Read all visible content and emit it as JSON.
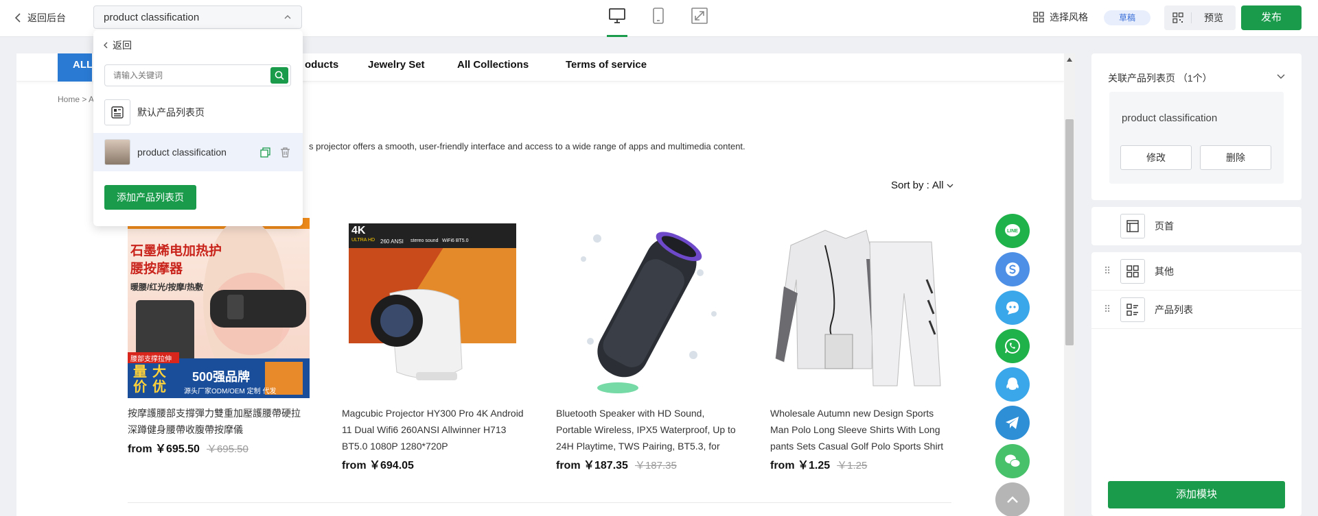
{
  "topbar": {
    "back_label": "返回后台",
    "page_select_value": "product classification",
    "style_label": "选择风格",
    "status_badge": "草稿",
    "preview_label": "预览",
    "publish_label": "发布"
  },
  "dropdown": {
    "back_label": "返回",
    "search_placeholder": "请输入关键词",
    "items": [
      {
        "label": "默认产品列表页"
      },
      {
        "label": "product classification"
      }
    ],
    "add_label": "添加产品列表页"
  },
  "canvas": {
    "nav_all": "ALL",
    "nav_items": [
      "oducts",
      "Jewelry Set",
      "All Collections",
      "Terms of service"
    ],
    "breadcrumb": "Home > A",
    "description": "s projector offers a smooth, user-friendly interface and access to a wide range of apps and multimedia content.",
    "sort_label": "Sort by :",
    "sort_value": "All",
    "products": [
      {
        "title": "按摩護腰部支撐彈力雙重加壓護腰帶硬拉深蹲健身腰帶收腹帶按摩儀",
        "price": "from ￥695.50",
        "old_price": "￥695.50"
      },
      {
        "title": "Magcubic Projector HY300 Pro 4K Android 11 Dual Wifi6 260ANSI Allwinner H713 BT5.0 1080P 1280*720P",
        "price": "from ￥694.05",
        "old_price": ""
      },
      {
        "title": "Bluetooth Speaker with HD Sound, Portable Wireless, IPX5 Waterproof, Up to 24H Playtime, TWS Pairing, BT5.3, for",
        "price": "from ￥187.35",
        "old_price": "￥187.35"
      },
      {
        "title": "Wholesale Autumn new Design Sports Man Polo Long Sleeve Shirts With Long pants Sets Casual Golf Polo Sports Shirt",
        "price": "from ￥1.25",
        "old_price": "￥1.25"
      }
    ],
    "product1_badges": {
      "brand_cn": "石墨烯电加热护腰按摩器",
      "sub_cn": "暖腰/红光/按摩/热敷",
      "support_cn": "腰部支撑拉伸",
      "big_cn": "量大价优",
      "strong": "500强品牌",
      "factory": "源头厂家ODM/OEM 定制 代发"
    },
    "product2_badges": {
      "k4": "4K",
      "ultra": "ULTRA HD",
      "ansi": "260 ANSI",
      "stereo": "stereo sound",
      "wifi": "WiFi6 BT5.0"
    },
    "social": [
      {
        "name": "line",
        "color": "#1fb14a",
        "label": "LINE"
      },
      {
        "name": "skype",
        "color": "#4d8fe6"
      },
      {
        "name": "messenger-bot",
        "color": "#3aa7ea"
      },
      {
        "name": "whatsapp",
        "color": "#1fb14a"
      },
      {
        "name": "qq",
        "color": "#3aa7ea"
      },
      {
        "name": "telegram",
        "color": "#2e8fd6"
      },
      {
        "name": "wechat",
        "color": "#48c16b"
      },
      {
        "name": "scroll-top",
        "color": "#b5b5b5"
      }
    ]
  },
  "rpanel": {
    "linked_title": "关联产品列表页 （1个）",
    "linked_name": "product classification",
    "edit_label": "修改",
    "delete_label": "删除",
    "modules": [
      {
        "label": "页首"
      },
      {
        "label": "其他"
      },
      {
        "label": "产品列表"
      }
    ],
    "add_module_label": "添加模块"
  },
  "colors": {
    "brand_green": "#1a9b4b",
    "nav_blue": "#2a7ad4"
  }
}
